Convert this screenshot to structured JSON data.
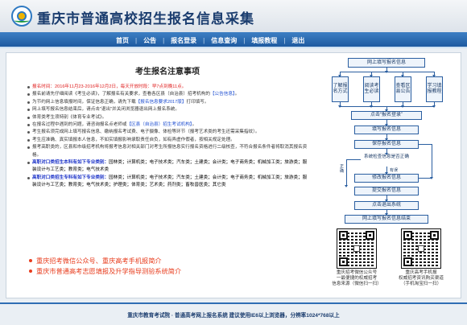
{
  "header": {
    "title": "重庆市普通高校招生报名信息采集"
  },
  "nav": {
    "items": [
      "首页",
      "公告",
      "报名登录",
      "信息查询",
      "填报教程",
      "退出"
    ]
  },
  "notice": {
    "title": "考生报名注意事项",
    "items": [
      {
        "label": "报名时间：",
        "value": "2016年11月23-2016年12月2日，每天开放时段：早7点到晚11点。"
      },
      {
        "pre": "报名前请先仔细阅读《考生必读》，了解报名有关要求，查看各区县（自治县）招考机构的",
        "link": "【公告信息】",
        "post": "。"
      },
      {
        "pre": "为节约网上信息填报时间，保证信息正确，请先下载",
        "link": "【报名信息要求2017版】",
        "post": "打印填写。"
      },
      {
        "text": "网上填写报名信息结束后，请点击\"退出\"并关闭浏览器退出网上报名系统。"
      },
      {
        "text": "体育类考生须特别《体育专业考试》。"
      },
      {
        "pre": "在报名过程中遇到的问题，请咨询报名点老师或",
        "link": "【区县（自治县）招生考试机构】",
        "post": "。"
      },
      {
        "text": "考生报名须完成网上填写报名信息、缴纳报名考试费、电子摄像、体检等环节（报考艺术类的考生还需采集指纹）。"
      },
      {
        "text": "考生应准确、真实填报本人信息，不如实填报影响录取责任自负，如有弄虚作假者，按相关规定处理。"
      },
      {
        "text": "报考高职类的，区县和市级招考机构将报考信息对相关部门对考生所报信息实行报名资格进行二级核查，不符合报名条件者将取消其报名资格。"
      }
    ],
    "category_lines": [
      {
        "head": "高职对口类招生本科有如下专业类别：",
        "list": "园林类；计算机类；电子技术类；汽车类；土建类；会计类；电子商务类；机械加工类；旅游类；服装设计与工艺类；教育类；电气技术类"
      },
      {
        "head": "高职对口类招生专科有如下专业类别：",
        "list": "园林类；计算机类；电子技术类；汽车类；土建类；会计类；电子商务类；机械加工类；旅游类；服装设计与工艺类；教育类；电气技术类；护理类；体育类；艺术类；药剂类；畜牧兽医类；其它类"
      }
    ],
    "links": [
      "重庆招考微信公众号、重庆高考手机报简介",
      "重庆市普通高考志愿填报及升学指导测验系统简介"
    ]
  },
  "flowchart": {
    "top": "网上填写报名信息",
    "row": [
      "了解报名方式",
      "阅读考生必读",
      "查看区县公告",
      "学习填报教程"
    ],
    "login": "点击“报名登录”",
    "fill": "填写报名信息",
    "save": "保存报名信息",
    "decision": "系统检查信息是否正确",
    "has_error": "有误",
    "modify": "修改报名信息",
    "correct": "正确",
    "submit": "提交报名信息",
    "exit": "点击退出系统",
    "end": "网上填写报名信息结束"
  },
  "qr_codes": [
    {
      "caption": "重庆招考微信公众号\n一最便捷的权威招考\n信息来源（微信扫一扫）"
    },
    {
      "caption": "重庆高考手机报\n权威招考资讯购买渠道\n（手机淘宝扫一扫）"
    }
  ],
  "footer": {
    "text": "重庆市教育考试院 · 普通高考网上报名系统    建议使用IE6以上浏览器，分辨率1024*768以上"
  },
  "colors": {
    "nav_bg": "#1e5aa0",
    "title_color": "#1a3c6e",
    "highlight_red": "#e02020",
    "link_blue": "#1f4fd1",
    "category_blue": "#1b32c8",
    "bottom_link_orange": "#e83d1e"
  }
}
